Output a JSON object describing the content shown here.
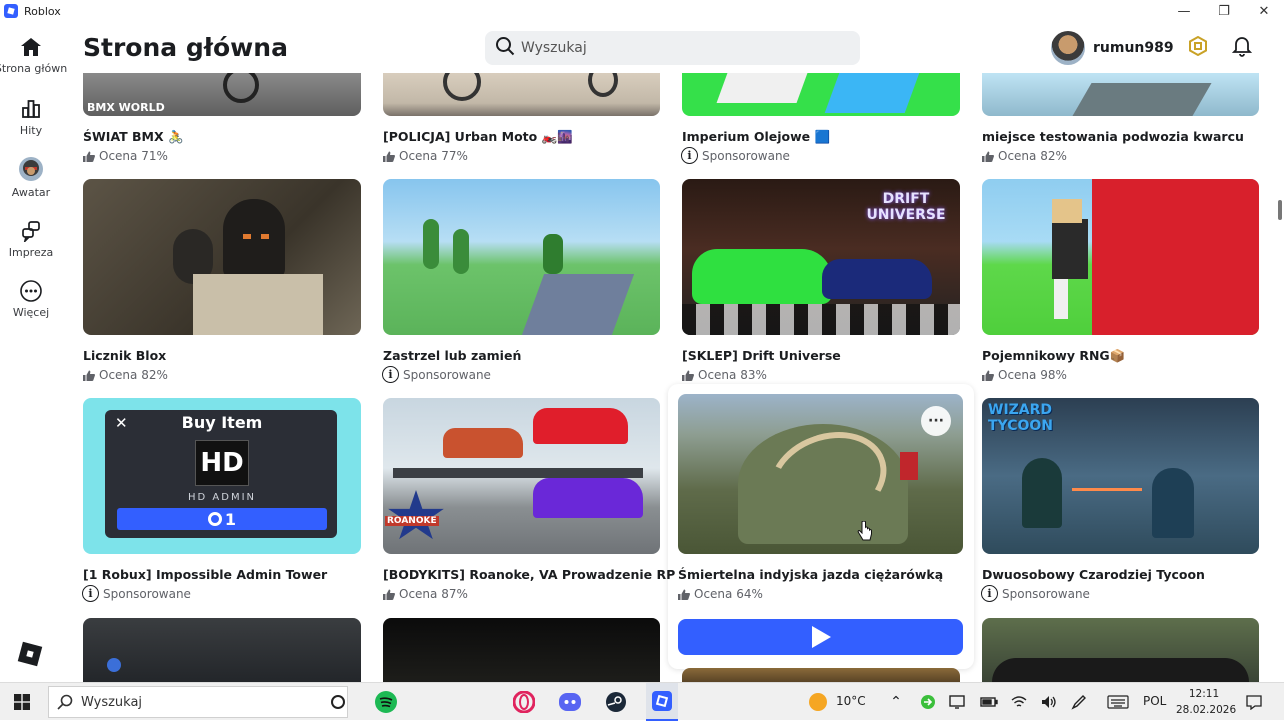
{
  "window": {
    "app_name": "Roblox",
    "minimize": "—",
    "maximize": "❐",
    "close": "✕"
  },
  "nav": [
    {
      "label": "Strona główn",
      "icon": "home-icon"
    },
    {
      "label": "Hity",
      "icon": "charts-icon"
    },
    {
      "label": "Awatar",
      "icon": "avatar-icon"
    },
    {
      "label": "Impreza",
      "icon": "party-icon"
    },
    {
      "label": "Więcej",
      "icon": "more-icon"
    }
  ],
  "header": {
    "title": "Strona główna",
    "search_placeholder": "Wyszukaj",
    "username": "rumun989"
  },
  "games": [
    {
      "title": "ŚWIAT BMX 🚴",
      "meta": "Ocena 71%",
      "type": "rating",
      "thumb_text": "BMX WORLD"
    },
    {
      "title": "[POLICJA] Urban Moto 🏍️🌆",
      "meta": "Ocena 77%",
      "type": "rating"
    },
    {
      "title": "Imperium Olejowe 🟦",
      "meta": "Sponsorowane",
      "type": "sponsored"
    },
    {
      "title": "miejsce testowania podwozia kwarcu",
      "meta": "Ocena 82%",
      "type": "rating"
    },
    {
      "title": "Licznik Blox",
      "meta": "Ocena 82%",
      "type": "rating"
    },
    {
      "title": "Zastrzel lub zamień",
      "meta": "Sponsorowane",
      "type": "sponsored"
    },
    {
      "title": "[SKLEP] Drift Universe",
      "meta": "Ocena 83%",
      "type": "rating",
      "thumb_text": "DRIFT UNIVERSE"
    },
    {
      "title": "Pojemnikowy RNG📦",
      "meta": "Ocena 98%",
      "type": "rating"
    },
    {
      "title": "[1 Robux] Impossible Admin Tower",
      "meta": "Sponsorowane",
      "type": "sponsored",
      "thumb_text": "Buy Item",
      "thumb_sub": "HD ADMIN",
      "thumb_logo": "HD",
      "thumb_price": "1"
    },
    {
      "title": "[BODYKITS] Roanoke, VA Prowadzenie RP",
      "meta": "Ocena 87%",
      "type": "rating",
      "thumb_text": "ROANOKE"
    },
    {
      "title": "Śmiertelna indyjska jazda ciężarówką",
      "meta": "Ocena 64%",
      "type": "rating"
    },
    {
      "title": "Dwuosobowy Czarodziej Tycoon",
      "meta": "Sponsorowane",
      "type": "sponsored",
      "thumb_text": "WIZARD TYCOON"
    }
  ],
  "taskbar": {
    "search_label": "Wyszukaj",
    "weather": "10°C",
    "lang": "POL",
    "time": "12:11",
    "date": "28.02.2026"
  },
  "colors": {
    "accent": "#335fff",
    "text": "#1b1d20",
    "muted": "#606268"
  }
}
